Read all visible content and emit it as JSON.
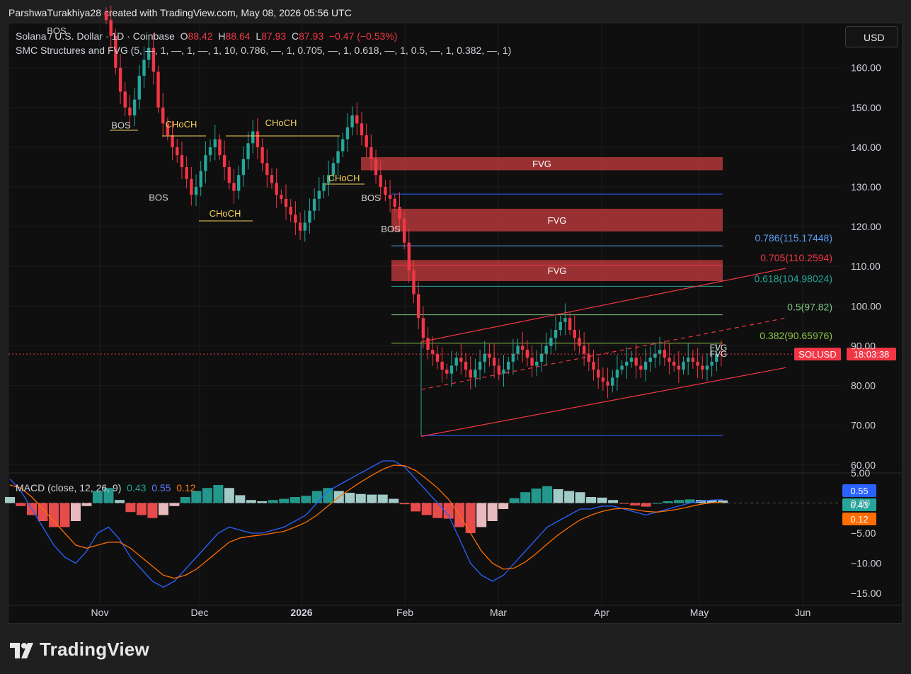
{
  "caption": "ParshwaTurakhiya28 created with TradingView.com, May 08, 2026 05:56 UTC",
  "legend": {
    "symbol": "Solana / U.S. Dollar · 1D · Coinbase",
    "o_label": "O",
    "o": "88.42",
    "h_label": "H",
    "h": "88.64",
    "l_label": "L",
    "l": "87.93",
    "c_label": "C",
    "c": "87.93",
    "change": "−0.47 (−0.53%)",
    "indicator": "SMC Structures and FVG (5, —, 1, —, 1, —, 1, 10, 0.786, —, 1, 0.705, —, 1, 0.618, —, 1, 0.5, —, 1, 0.382, —, 1)"
  },
  "currency": "USD",
  "brand": "TradingView",
  "macd_legend": {
    "label": "MACD (close, 12, 26, 9)",
    "hist": "0.43",
    "macd": "0.55",
    "signal": "0.12"
  },
  "colors": {
    "up": "#26a69a",
    "down": "#f23645",
    "macd_line": "#2962ff",
    "signal_line": "#ff6d00",
    "fvg": "#b2373a",
    "structure": "#f7d25a"
  },
  "chart_data": [
    {
      "type": "candlestick",
      "symbol": "SOLUSD",
      "title": "Solana / U.S. Dollar · 1D · Coinbase",
      "x_ticks": [
        "Nov",
        "Dec",
        "2026",
        "Feb",
        "Mar",
        "Apr",
        "May",
        "Jun"
      ],
      "y_ticks": [
        "60.00",
        "70.00",
        "80.00",
        "90.00",
        "100.00",
        "110.00",
        "120.00",
        "130.00",
        "140.00",
        "150.00",
        "160.00"
      ],
      "ylim": [
        58,
        171
      ],
      "last_price": 87.93,
      "price_tag": {
        "symbol": "SOLUSD",
        "countdown": "18:03:38"
      },
      "ohlc_last": {
        "open": 88.42,
        "high": 88.64,
        "low": 87.93,
        "close": 87.93
      },
      "fvg_zones": [
        {
          "label": "FVG",
          "top": 137.5,
          "bottom": 134.2
        },
        {
          "label": "FVG",
          "top": 124.5,
          "bottom": 118.8
        },
        {
          "label": "FVG",
          "top": 111.6,
          "bottom": 106.3
        }
      ],
      "small_fvg_labels": [
        "FVG",
        "FVG"
      ],
      "fib_levels": [
        {
          "label": "0.786(115.17448)",
          "value": 115.17448,
          "color": "#5b9cf6"
        },
        {
          "label": "0.705(110.2594)",
          "value": 110.2594,
          "color": "#f23645"
        },
        {
          "label": "0.618(104.98024)",
          "value": 104.98024,
          "color": "#26a69a"
        },
        {
          "label": "0.5(97.82)",
          "value": 97.82,
          "color": "#81c784"
        },
        {
          "label": "0.382(90.65976)",
          "value": 90.65976,
          "color": "#8bc34a"
        }
      ],
      "range_top": 128.2,
      "range_bottom": 67.4,
      "structure_labels": [
        {
          "label": "BOS"
        },
        {
          "label": "BOS"
        },
        {
          "label": "CHoCH"
        },
        {
          "label": "CHoCH"
        },
        {
          "label": "BOS"
        },
        {
          "label": "CHoCH"
        },
        {
          "label": "CHoCH"
        },
        {
          "label": "BOS"
        },
        {
          "label": "BOS"
        }
      ],
      "channel": {
        "lower": [
          [
            "Feb 03",
            67.2
          ],
          [
            "May 16",
            84.5
          ]
        ],
        "upper": [
          [
            "Feb 03",
            91.0
          ],
          [
            "May 16",
            109.5
          ]
        ],
        "mid": [
          [
            "Feb 03",
            79.0
          ],
          [
            "May 16",
            97.0
          ]
        ]
      },
      "closes": [
        172,
        168,
        160,
        154,
        150,
        148,
        152,
        158,
        162,
        165,
        159,
        150,
        146,
        143,
        140,
        138,
        135,
        132,
        128,
        130,
        134,
        138,
        140,
        142,
        138,
        135,
        131,
        129,
        133,
        137,
        141,
        144,
        140,
        136,
        133,
        131,
        128,
        127,
        125,
        123,
        121,
        119,
        121,
        124,
        127,
        129,
        131,
        133,
        136,
        139,
        142,
        145,
        148,
        146,
        143,
        140,
        137,
        133,
        130,
        128,
        127,
        125,
        122,
        116,
        109,
        103,
        97,
        92,
        89,
        88,
        86,
        84,
        83,
        85,
        87,
        86,
        84,
        82,
        84,
        86,
        88,
        87,
        85,
        83,
        84,
        86,
        88,
        90,
        89,
        87,
        85,
        86,
        88,
        90,
        92,
        94,
        96,
        97,
        94,
        92,
        90,
        88,
        86,
        84,
        82,
        81,
        80,
        82,
        84,
        85,
        86,
        87,
        85,
        84,
        86,
        87,
        88,
        89,
        87,
        86,
        85,
        84,
        86,
        87,
        86,
        85,
        84,
        85,
        86,
        88,
        87.93
      ]
    },
    {
      "type": "line",
      "title": "MACD (close, 12, 26, 9)",
      "y_ticks": [
        "5.00",
        "0.00",
        "−5.00",
        "−10.00",
        "−15.00"
      ],
      "ylim": [
        -17,
        5
      ],
      "last": {
        "macd": 0.55,
        "hist": 0.43,
        "signal": 0.12
      },
      "series": [
        {
          "name": "MACD",
          "values": [
            4,
            2,
            -1,
            -4,
            -7,
            -9,
            -10,
            -8,
            -5,
            -4,
            -6,
            -9,
            -11,
            -13,
            -14,
            -13,
            -11,
            -9,
            -7,
            -5,
            -4,
            -4.5,
            -5,
            -5,
            -4.5,
            -4,
            -3,
            -2,
            0,
            2,
            3,
            4,
            5,
            6,
            7,
            7,
            6,
            4,
            2,
            0,
            -2,
            -6,
            -10,
            -12,
            -13,
            -12,
            -10,
            -8,
            -6,
            -4,
            -3,
            -2,
            -1,
            -1,
            -0.5,
            -0.5,
            -1,
            -1.5,
            -2,
            -1.5,
            -1,
            -0.5,
            0,
            0.3,
            0.5,
            0.55
          ]
        },
        {
          "name": "Signal",
          "values": [
            3,
            2.5,
            1,
            -1,
            -3,
            -5,
            -7,
            -7.5,
            -7,
            -6.5,
            -6.5,
            -7.5,
            -9,
            -10.5,
            -12,
            -12.5,
            -12,
            -11,
            -9.5,
            -8,
            -6.5,
            -5.8,
            -5.5,
            -5.3,
            -5,
            -4.7,
            -4,
            -3.2,
            -2,
            -0.5,
            1,
            2.3,
            3.5,
            4.6,
            5.6,
            6.3,
            6.2,
            5.4,
            4,
            2.5,
            0.6,
            -2,
            -5,
            -8,
            -10,
            -11,
            -10.8,
            -9.8,
            -8.4,
            -6.8,
            -5.3,
            -4,
            -2.8,
            -2,
            -1.4,
            -1,
            -0.9,
            -1.1,
            -1.4,
            -1.5,
            -1.3,
            -1,
            -0.6,
            -0.2,
            0.05,
            0.12
          ]
        }
      ]
    }
  ]
}
